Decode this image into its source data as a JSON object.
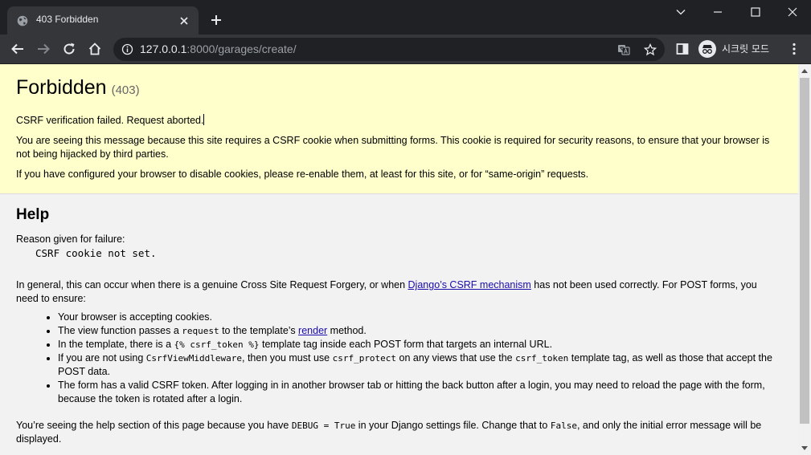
{
  "browser": {
    "tab": {
      "title": "403 Forbidden"
    },
    "address": {
      "host": "127.0.0.1",
      "rest": ":8000/garages/create/"
    },
    "profile": {
      "label": "시크릿 모드"
    }
  },
  "page": {
    "title": "Forbidden",
    "status_code": "(403)",
    "summary": {
      "failed": "CSRF verification failed. Request aborted.",
      "explanation": "You are seeing this message because this site requires a CSRF cookie when submitting forms. This cookie is required for security reasons, to ensure that your browser is not being hijacked by third parties.",
      "cookies_hint": "If you have configured your browser to disable cookies, please re-enable them, at least for this site, or for “same-origin” requests."
    },
    "help": {
      "heading": "Help",
      "reason_label": "Reason given for failure:",
      "reason_code": "CSRF cookie not set.",
      "general_before": "In general, this can occur when there is a genuine Cross Site Request Forgery, or when ",
      "general_link": "Django’s CSRF mechanism",
      "general_after": " has not been used correctly. For POST forms, you need to ensure:",
      "items": {
        "i1": "Your browser is accepting cookies.",
        "i2_a": "The view function passes a ",
        "i2_code": "request",
        "i2_b": " to the template’s ",
        "i2_link": "render",
        "i2_c": " method.",
        "i3_a": "In the template, there is a ",
        "i3_code": "{% csrf_token %}",
        "i3_b": " template tag inside each POST form that targets an internal URL.",
        "i4_a": "If you are not using ",
        "i4_code1": "CsrfViewMiddleware",
        "i4_b": ", then you must use ",
        "i4_code2": "csrf_protect",
        "i4_c": " on any views that use the ",
        "i4_code3": "csrf_token",
        "i4_d": " template tag, as well as those that accept the POST data.",
        "i5": "The form has a valid CSRF token. After logging in in another browser tab or hitting the back button after a login, you may need to reload the page with the form, because the token is rotated after a login."
      },
      "debug_a": "You’re seeing the help section of this page because you have ",
      "debug_code1": "DEBUG = True",
      "debug_b": " in your Django settings file. Change that to ",
      "debug_code2": "False",
      "debug_c": ", and only the initial error message will be displayed."
    }
  },
  "icons": {
    "tab_favicon": "globe-icon",
    "tab_close": "close-icon",
    "new_tab": "plus-icon",
    "minimize": "minimize-icon",
    "maximize": "maximize-icon",
    "close_window": "close-icon",
    "tab_search": "chevron-down-icon",
    "back": "back-arrow-icon",
    "forward": "forward-arrow-icon",
    "reload": "reload-icon",
    "home": "home-icon",
    "site_info": "info-icon",
    "translate": "translate-icon",
    "bookmark": "star-icon",
    "side_panel": "side-panel-icon",
    "incognito": "incognito-icon",
    "menu": "kebab-menu-icon"
  },
  "colors": {
    "summary_bg": "#ffffcc",
    "body_bg": "#f2f2f2",
    "link": "#1a0dab",
    "chrome_dark": "#202124",
    "chrome_toolbar": "#35363a"
  }
}
